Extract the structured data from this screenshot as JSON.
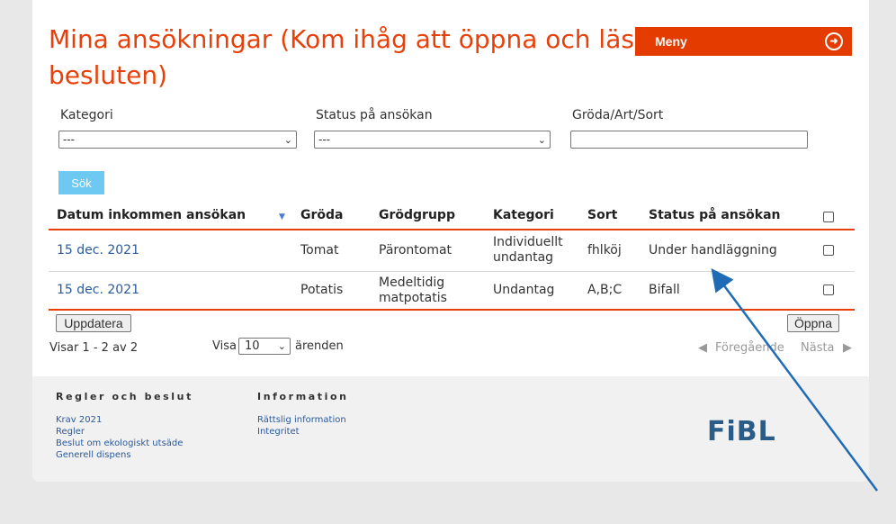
{
  "page": {
    "title": "Mina ansökningar (Kom ihåg att öppna och läs besluten)",
    "menu_label": "Meny",
    "menu_icon": "arrow-right-circle-icon"
  },
  "filters": {
    "category": {
      "label": "Kategori",
      "value": "---"
    },
    "status": {
      "label": "Status på ansökan",
      "value": "---"
    },
    "crop": {
      "label": "Gröda/Art/Sort",
      "value": ""
    },
    "search_button": "Sök"
  },
  "table": {
    "headers": [
      "Datum inkommen ansökan",
      "Gröda",
      "Grödgrupp",
      "Kategori",
      "Sort",
      "Status på ansökan"
    ],
    "rows": [
      {
        "date": "15 dec. 2021",
        "crop": "Tomat",
        "group": "Pärontomat",
        "category": "Individuellt undantag",
        "sort": "fhlköj",
        "status": "Under handläggning"
      },
      {
        "date": "15 dec. 2021",
        "crop": "Potatis",
        "group": "Medeltidig matpotatis",
        "category": "Undantag",
        "sort": "A,B;C",
        "status": "Bifall"
      }
    ]
  },
  "actions": {
    "update": "Uppdatera",
    "open": "Öppna"
  },
  "paging": {
    "showing": "Visar 1 - 2 av 2",
    "show_label": "Visa",
    "per_page": "10",
    "unit": "ärenden",
    "prev": "Föregående",
    "next": "Nästa"
  },
  "footer": {
    "col1": {
      "heading": "Regler och beslut",
      "links": [
        "Krav 2021",
        "Regler",
        "Beslut om ekologiskt utsäde",
        "Generell dispens"
      ]
    },
    "col2": {
      "heading": "Information",
      "links": [
        "Rättslig information",
        "Integritet"
      ]
    },
    "logo": "FiBL"
  },
  "colors": {
    "accent": "#e8400a",
    "search_button": "#6dc8f2",
    "link": "#2a5a9c",
    "annotation_arrow": "#1f6bb5"
  }
}
